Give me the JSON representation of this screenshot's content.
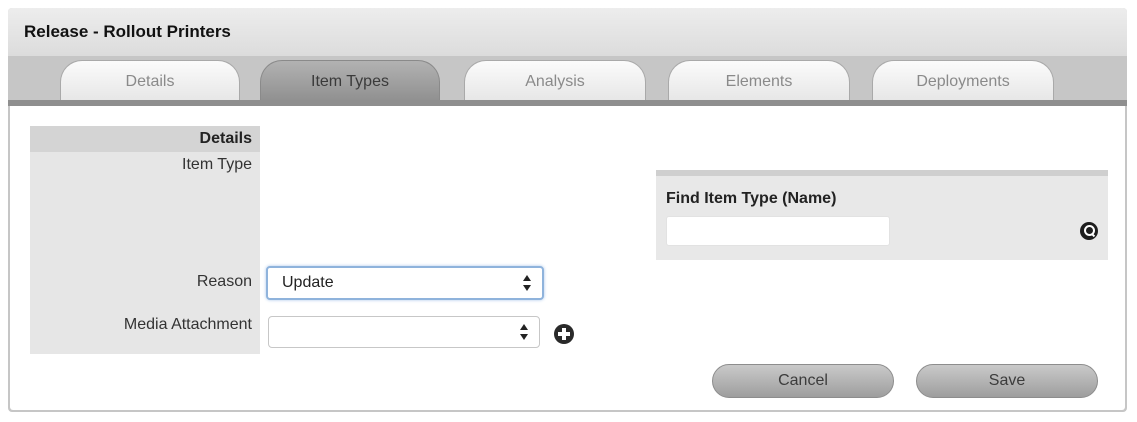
{
  "window": {
    "title": "Release - Rollout Printers"
  },
  "tabs": [
    {
      "label": "Details",
      "active": false
    },
    {
      "label": "Item Types",
      "active": true
    },
    {
      "label": "Analysis",
      "active": false
    },
    {
      "label": "Elements",
      "active": false
    },
    {
      "label": "Deployments",
      "active": false
    }
  ],
  "form": {
    "section_label": "Details",
    "item_type_label": "Item Type",
    "reason_label": "Reason",
    "reason_value": "Update",
    "media_label": "Media Attachment",
    "media_value": ""
  },
  "find_panel": {
    "title": "Find Item Type (Name)",
    "input_value": ""
  },
  "buttons": {
    "cancel": "Cancel",
    "save": "Save"
  },
  "icons": {
    "search": "search-icon",
    "add": "plus-circle-icon",
    "select_arrows": "up-down-arrows-icon"
  },
  "colors": {
    "active_tab": "#9e9e9e",
    "focus_ring": "#8fb3dc"
  }
}
